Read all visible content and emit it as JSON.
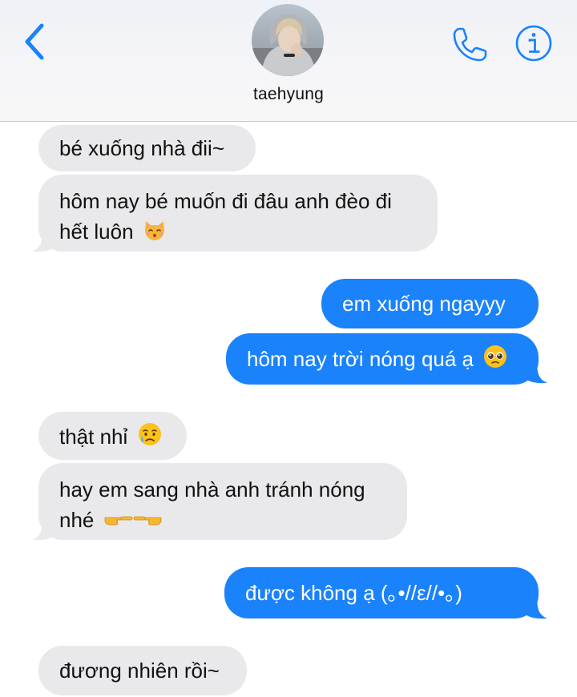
{
  "header": {
    "contact_name": "taehyung",
    "back_icon": "chevron-left-icon",
    "call_icon": "phone-icon",
    "info_icon": "info-icon",
    "accent_color": "#1a82fb"
  },
  "messages": [
    {
      "from": "them",
      "text": "bé xuống nhà đii~"
    },
    {
      "from": "them",
      "line1": "hôm nay bé muốn đi đâu anh đèo đi",
      "line2": "hết luôn",
      "emoji": "kissing-cat-emoji"
    },
    {
      "from": "me",
      "text": "em xuống ngayyy"
    },
    {
      "from": "me",
      "text": "hôm nay trời nóng quá ạ",
      "emoji": "pleading-face-emoji"
    },
    {
      "from": "them",
      "text": "thật nhỉ",
      "emoji": "sad-relieved-face-emoji"
    },
    {
      "from": "them",
      "line1": "hay em sang nhà anh tránh nóng",
      "line2": "nhé",
      "emoji": "pointing-fingers-emoji"
    },
    {
      "from": "me",
      "text": "được không ạ (｡•//ε//•｡)"
    },
    {
      "from": "them",
      "text": "đương nhiên rồi~"
    }
  ],
  "colors": {
    "sent_bubble": "#1a82fb",
    "received_bubble": "#e9e9eb"
  }
}
